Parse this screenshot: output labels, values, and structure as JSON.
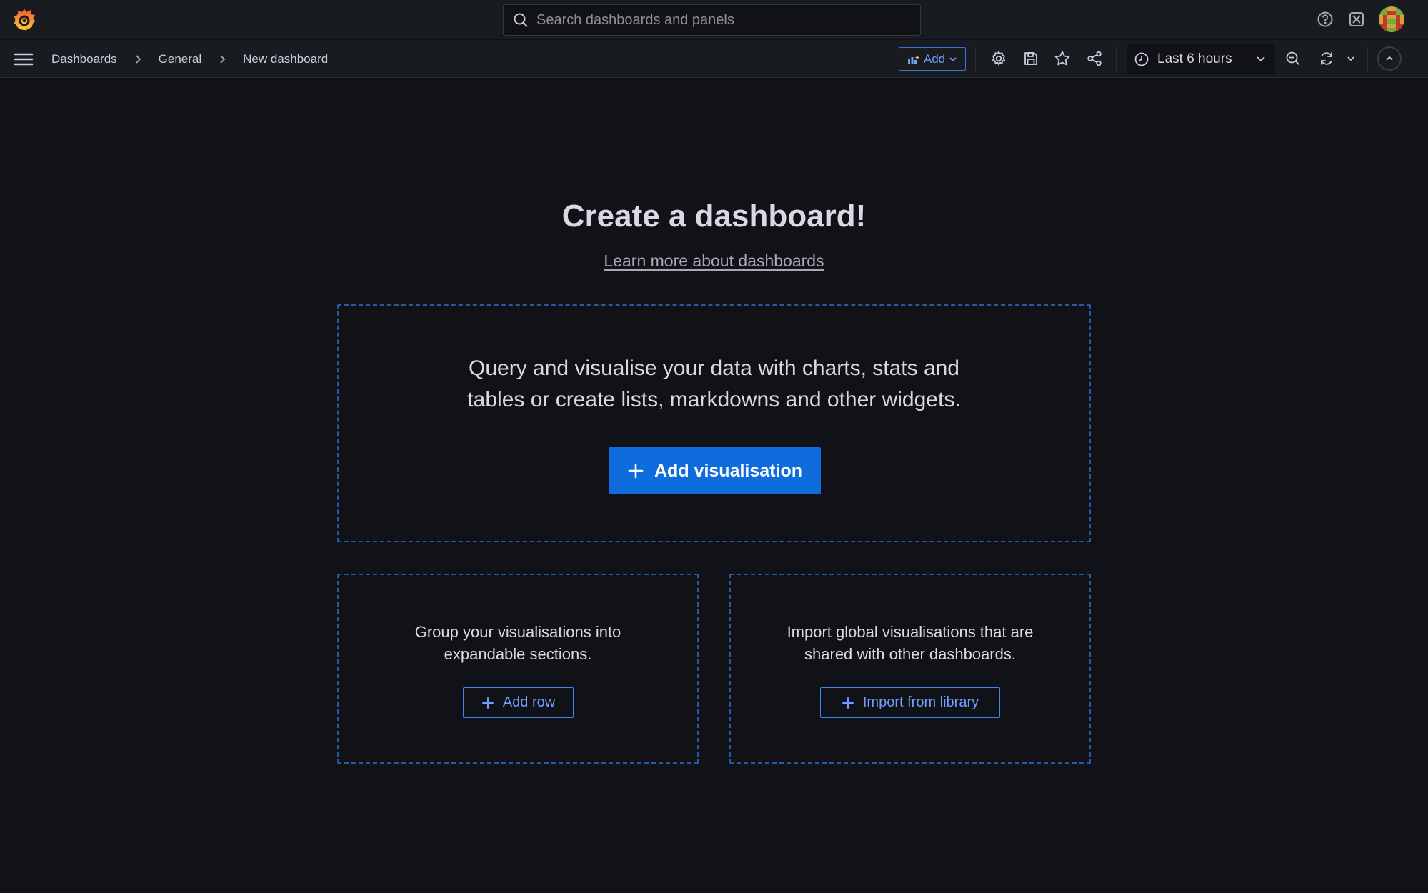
{
  "header": {
    "search_placeholder": "Search dashboards and panels"
  },
  "toolbar": {
    "breadcrumbs": [
      "Dashboards",
      "General",
      "New dashboard"
    ],
    "add_label": "Add",
    "time_range": "Last 6 hours"
  },
  "main": {
    "title": "Create a dashboard!",
    "learn_link": "Learn more about dashboards",
    "visualisation": {
      "line1": "Query and visualise your data with charts, stats and",
      "line2": "tables or create lists, markdowns and other widgets.",
      "button": "Add visualisation"
    },
    "row": {
      "line1": "Group your visualisations into",
      "line2": "expandable sections.",
      "button": "Add row"
    },
    "library": {
      "line1": "Import global visualisations that are",
      "line2": "shared with other dashboards.",
      "button": "Import from library"
    }
  },
  "colors": {
    "background": "#111217",
    "bar": "#181b1f",
    "primary": "#0f6cdd",
    "dashed_border": "#255a9c",
    "link_blue": "#6e9fff"
  },
  "icons": {
    "logo": "grafana-logo-icon",
    "help": "help-icon",
    "news": "news-icon",
    "menu": "hamburger-icon",
    "settings": "gear-icon",
    "save": "save-icon",
    "star": "star-icon",
    "share": "share-icon",
    "clock": "clock-icon",
    "zoom_out": "zoom-out-icon",
    "refresh": "refresh-icon",
    "collapse": "chevron-up-icon"
  }
}
